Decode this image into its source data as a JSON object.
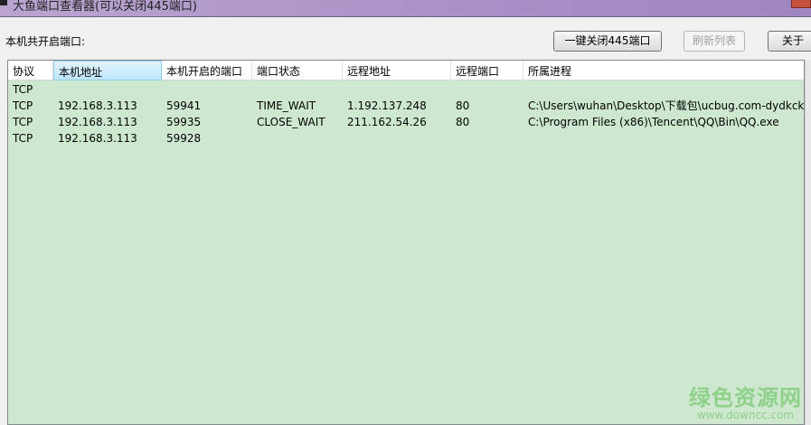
{
  "window": {
    "title": "大鱼端口查看器(可以关闭445端口)"
  },
  "toolbar": {
    "open_ports_label": "本机共开启端口:",
    "close445": "一键关闭445端口",
    "refresh": "刷新列表",
    "about": "关于"
  },
  "table": {
    "headers": [
      "协议",
      "本机地址",
      "本机开启的端口",
      "端口状态",
      "远程地址",
      "远程端口",
      "所属进程"
    ],
    "rows": [
      [
        "TCP",
        "",
        "",
        "",
        "",
        "",
        ""
      ],
      [
        "TCP",
        "192.168.3.113",
        "59941",
        "TIME_WAIT",
        "1.192.137.248",
        "80",
        "C:\\Users\\wuhan\\Desktop\\下载包\\ucbug.com-dydkckq\\大"
      ],
      [
        "TCP",
        "192.168.3.113",
        "59935",
        "CLOSE_WAIT",
        "211.162.54.26",
        "80",
        "C:\\Program Files (x86)\\Tencent\\QQ\\Bin\\QQ.exe"
      ],
      [
        "TCP",
        "192.168.3.113",
        "59928",
        "",
        "",
        "",
        ""
      ]
    ]
  },
  "watermark": {
    "name": "绿色资源网",
    "url": "www.downcc.com"
  }
}
